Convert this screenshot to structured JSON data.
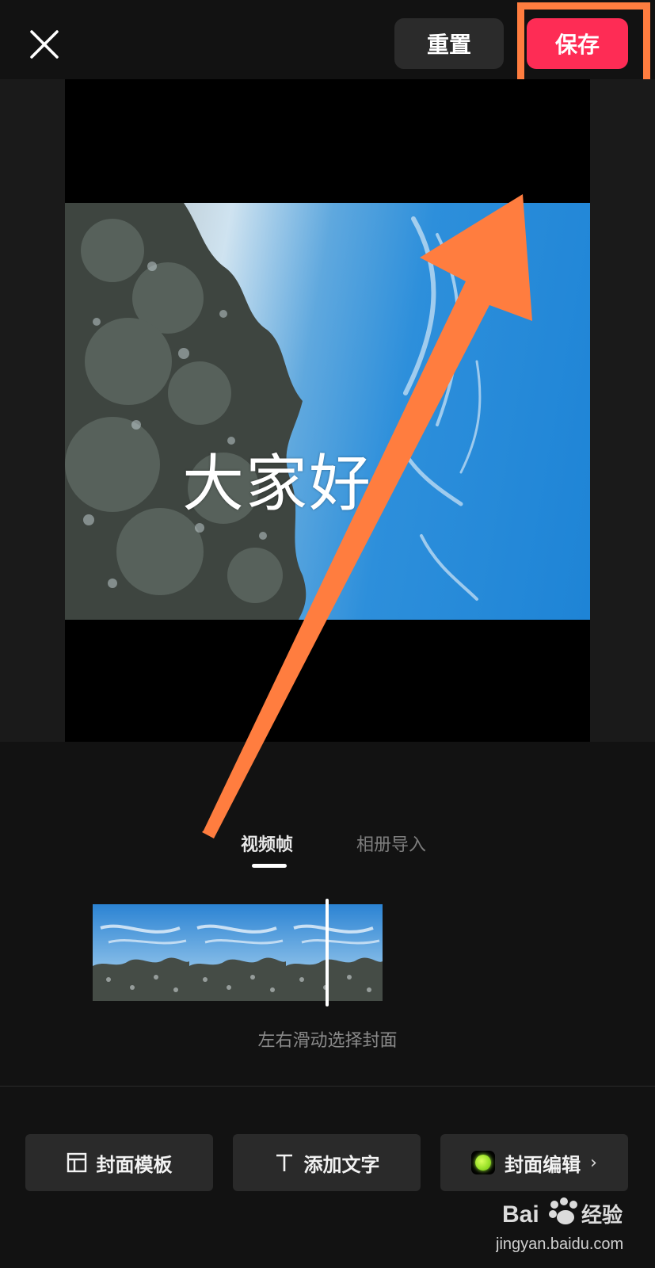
{
  "header": {
    "close_icon": "close-icon",
    "reset_label": "重置",
    "save_label": "保存"
  },
  "preview": {
    "cover_text": "大家好"
  },
  "tabs": [
    {
      "label": "视频帧",
      "active": true
    },
    {
      "label": "相册导入",
      "active": false
    }
  ],
  "filmstrip": {
    "frame_count": 3,
    "hint": "左右滑动选择封面"
  },
  "bottom_bar": {
    "template": {
      "label": "封面模板",
      "icon": "template-layout-icon"
    },
    "add_text": {
      "label": "添加文字",
      "icon": "text-t-icon"
    },
    "cover_edit": {
      "label": "封面编辑",
      "icon": "green-dot-icon",
      "chevron": "›"
    }
  },
  "colors": {
    "background": "#121212",
    "save_accent": "#fe2c55",
    "annotation": "#ff7d3f"
  },
  "watermark": {
    "brand": "Baidu经验",
    "url": "jingyan.baidu.com"
  }
}
